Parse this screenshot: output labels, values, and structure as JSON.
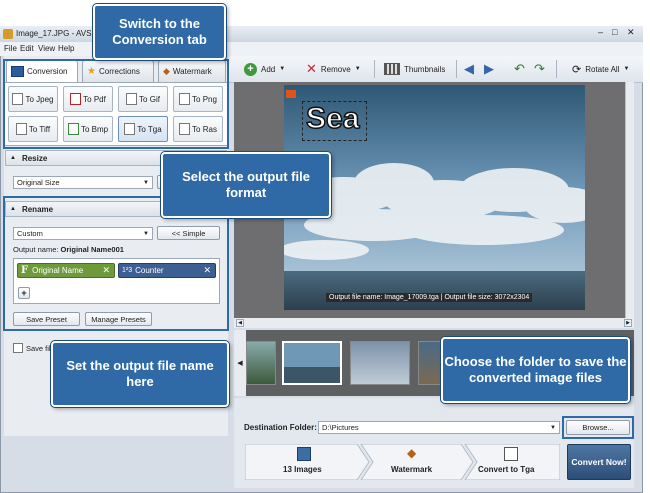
{
  "window": {
    "title": "Image_17.JPG - AVS"
  },
  "menu": [
    "File",
    "Edit",
    "View",
    "Help"
  ],
  "toolbar": {
    "add": "Add",
    "remove": "Remove",
    "thumbnails": "Thumbnails",
    "rotate_all": "Rotate All"
  },
  "tabs": {
    "conversion": "Conversion",
    "corrections": "Corrections",
    "watermark": "Watermark"
  },
  "formats": [
    "To Jpeg",
    "To Pdf",
    "To Gif",
    "To Png",
    "To Tiff",
    "To Bmp",
    "To Tga",
    "To Ras"
  ],
  "resize": {
    "header": "Resize",
    "value": "Original Size"
  },
  "rename": {
    "header": "Rename",
    "mode_value": "Custom",
    "simple_button": "<< Simple",
    "output_name_label": "Output name:",
    "output_name_value": "Original Name001",
    "chip_name": "Original Name",
    "chip_counter": "Counter",
    "add_symbol": "+",
    "save_preset": "Save Preset",
    "manage_presets": "Manage Presets"
  },
  "save_file_checkbox": "Save file",
  "preview": {
    "watermark_text": "Sea",
    "status": "Output file name: Image_17009.tga | Output file size: 3072x2304"
  },
  "destination": {
    "label": "Destination Folder:",
    "value": "D:\\Pictures",
    "browse": "Browse..."
  },
  "steps": {
    "images": "13 Images",
    "watermark": "Watermark",
    "convert_to": "Convert to Tga"
  },
  "convert_now": "Convert Now!",
  "callouts": {
    "conversion_tab": "Switch to the Conversion tab",
    "output_format": "Select the output file format",
    "output_name": "Set the output file name here",
    "folder": "Choose the folder to save the converted image files"
  },
  "colors": {
    "callout": "#2f6aa7",
    "name_chip": "#6f9a3c",
    "counter_chip": "#3e5f91",
    "convert_now": "#36587f"
  }
}
